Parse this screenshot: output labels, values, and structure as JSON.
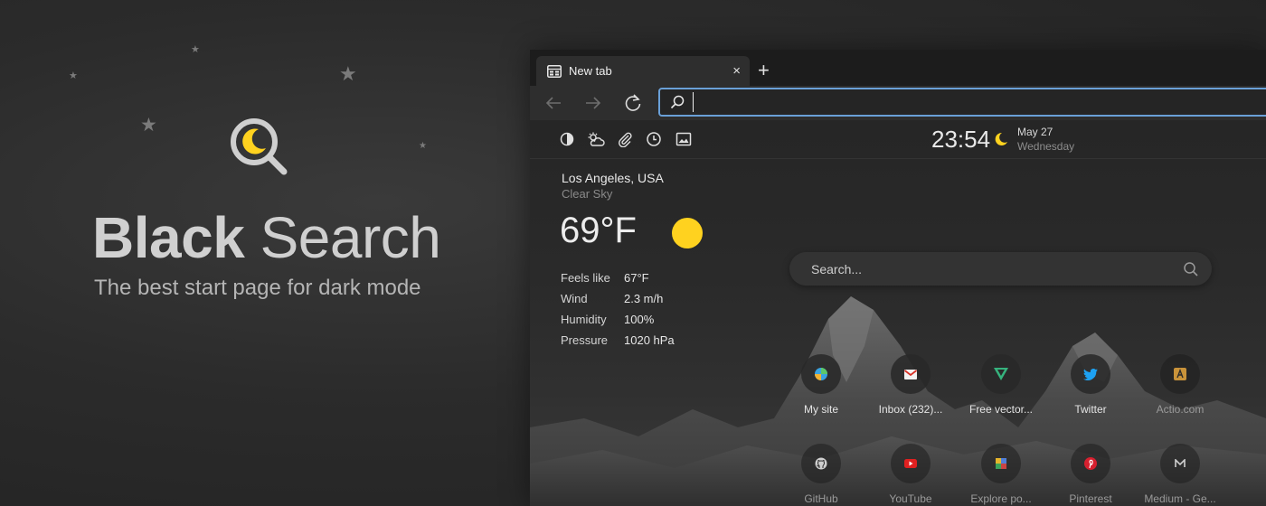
{
  "promo": {
    "brand_bold": "Black",
    "brand_light": "Search",
    "tagline": "The best start page for dark mode"
  },
  "browser": {
    "tab_title": "New tab",
    "tab_close": "×",
    "new_tab": "+",
    "address_value": ""
  },
  "newtab": {
    "clock": "23:54",
    "date": "May 27",
    "day": "Wednesday",
    "weather": {
      "city": "Los Angeles, USA",
      "condition": "Clear Sky",
      "temperature": "69°F",
      "details": [
        {
          "label": "Feels like",
          "value": "67°F"
        },
        {
          "label": "Wind",
          "value": "2.3 m/h"
        },
        {
          "label": "Humidity",
          "value": "100%"
        },
        {
          "label": "Pressure",
          "value": "1020 hPa"
        }
      ]
    },
    "search_placeholder": "Search...",
    "tiles": [
      {
        "label": "My site",
        "icon": "my-site-icon"
      },
      {
        "label": "Inbox (232)...",
        "icon": "gmail-icon"
      },
      {
        "label": "Free vector...",
        "icon": "vecteezy-icon"
      },
      {
        "label": "Twitter",
        "icon": "twitter-icon"
      },
      {
        "label": "Actio.com",
        "icon": "actio-icon"
      },
      {
        "label": "GitHub",
        "icon": "github-icon"
      },
      {
        "label": "YouTube",
        "icon": "youtube-icon"
      },
      {
        "label": "Explore po...",
        "icon": "explore-icon"
      },
      {
        "label": "Pinterest",
        "icon": "pinterest-icon"
      },
      {
        "label": "Medium - Ge...",
        "icon": "medium-icon"
      }
    ]
  },
  "colors": {
    "accent_focus": "#6aa0d8",
    "moon": "#ffd21f",
    "sun": "#ffd21f"
  }
}
